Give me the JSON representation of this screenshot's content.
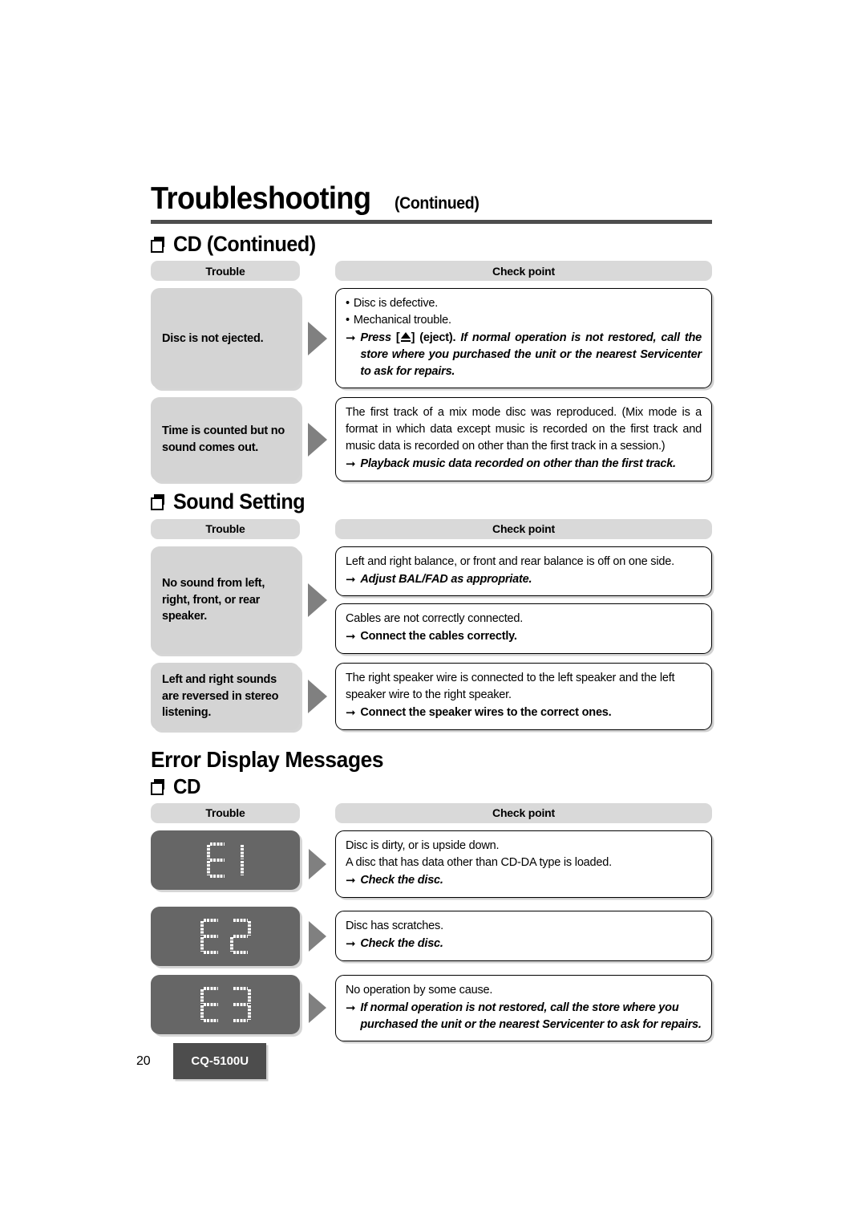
{
  "page": {
    "title_main": "Troubleshooting",
    "title_sub": "(Continued)",
    "page_number": "20",
    "model": "CQ-5100U"
  },
  "columns": {
    "trouble": "Trouble",
    "check_point": "Check point"
  },
  "sections": [
    {
      "id": "cd-continued",
      "heading": "CD (Continued)",
      "rows": [
        {
          "trouble": "Disc is not ejected.",
          "boxes": [
            {
              "bullets": [
                "Disc is defective.",
                "Mechanical trouble."
              ],
              "action_prefix": "Press",
              "action_eject_suffix": "(eject).",
              "action_italic": "If normal operation is not restored, call the store where you purchased the unit or the nearest Servicenter to ask for repairs.",
              "action_style": "italic"
            }
          ]
        },
        {
          "trouble": "Time is counted but no sound comes out.",
          "boxes": [
            {
              "body": "The first track of a mix mode disc was reproduced. (Mix mode is a format in which data except music is recorded on the first track and music data is recorded on other than the first track in a session.)",
              "action": "Playback music data recorded on other than the first track.",
              "action_style": "italic"
            }
          ]
        }
      ]
    },
    {
      "id": "sound-setting",
      "heading": "Sound Setting",
      "rows": [
        {
          "trouble": "No sound from left, right, front, or rear speaker.",
          "boxes": [
            {
              "body": "Left and right balance, or front and rear balance is off on one side.",
              "action": "Adjust BAL/FAD as appropriate.",
              "action_style": "italic"
            },
            {
              "body": "Cables are not correctly connected.",
              "action": "Connect the cables correctly.",
              "action_style": "upright"
            }
          ]
        },
        {
          "trouble": "Left and right sounds are reversed in stereo listening.",
          "boxes": [
            {
              "body": "The right speaker wire is connected to the left speaker and the left speaker wire to the right speaker.",
              "action": "Connect the speaker wires to the correct ones.",
              "action_style": "upright"
            }
          ]
        }
      ]
    }
  ],
  "error_display": {
    "heading": "Error Display Messages",
    "subheading": "CD",
    "rows": [
      {
        "code": "E1",
        "lines": [
          "Disc is dirty, or is upside down.",
          "A disc that has data other than CD-DA type is loaded."
        ],
        "action": "Check the disc.",
        "action_style": "italic"
      },
      {
        "code": "E2",
        "lines": [
          "Disc has scratches."
        ],
        "action": "Check the disc.",
        "action_style": "italic"
      },
      {
        "code": "E3",
        "lines": [
          "No operation by some cause."
        ],
        "action": "If normal operation is not restored, call the store where you purchased the unit or the nearest Servicenter to ask for repairs.",
        "action_style": "italic"
      }
    ]
  },
  "icons": {
    "section_marker": "square-stack-icon",
    "flow_arrow": "triangle-right-icon",
    "action_arrow": "arrow-right-icon",
    "eject": "eject-icon"
  },
  "colors": {
    "rule": "#4d4d4d",
    "pill_bg": "#d9d9d9",
    "trouble_bg": "#d4d4d4",
    "lcd_bg": "#666666",
    "lcd_fg": "#ffffff",
    "arrow": "#808080",
    "model_badge_bg": "#4d4d4d"
  }
}
